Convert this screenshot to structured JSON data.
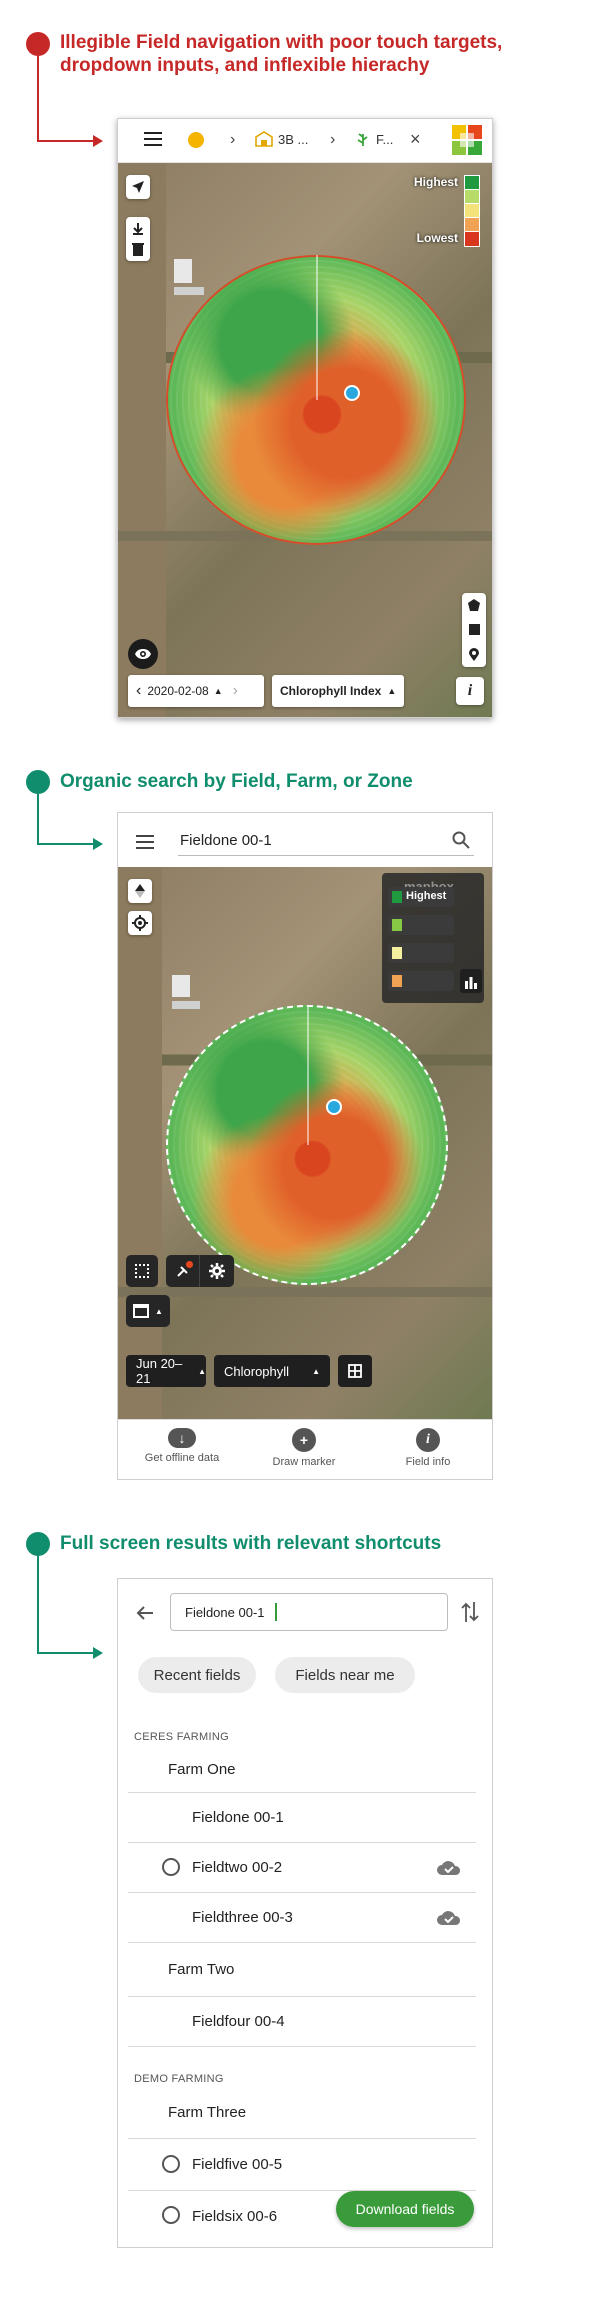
{
  "annotations": [
    {
      "title_line1": "Illegible Field navigation with poor touch targets,",
      "title_line2": "dropdown inputs, and inflexible hierachy",
      "color": "#c62828"
    },
    {
      "title_line1": "Organic search by Field, Farm, or Zone",
      "color": "#108d6d"
    },
    {
      "title_line1": "Full screen results with relevant shortcuts",
      "color": "#108d6d"
    }
  ],
  "screen1": {
    "breadcrumb": {
      "crumb1": "3B ...",
      "crumb2": "F..."
    },
    "legend": {
      "high": "Highest",
      "low": "Lowest",
      "colors": [
        "#1f9a3f",
        "#b7dc6a",
        "#f4e37a",
        "#f0a354",
        "#d9361f"
      ]
    },
    "date": "2020-02-08",
    "layer": "Chlorophyll Index",
    "info_label": "i"
  },
  "screen2": {
    "search_value": "Fieldone 00-1",
    "legend": {
      "high": "Highest",
      "watermark": "mapbox",
      "colors": [
        "#1f9a3f",
        "#86c945",
        "#f4f0a0",
        "#f0a354"
      ]
    },
    "date_tab": "Jun 20–21",
    "layer_tab": "Chlorophyll",
    "nav": [
      {
        "label": "Get offline data",
        "icon": "cloud-download-icon"
      },
      {
        "label": "Draw marker",
        "icon": "marker-add-icon"
      },
      {
        "label": "Field info",
        "icon": "info-icon"
      }
    ]
  },
  "screen3": {
    "search_value": "Fieldone 00-1",
    "chips": [
      "Recent fields",
      "Fields near me"
    ],
    "groups": [
      {
        "heading": "CERES FARMING",
        "items": [
          {
            "label": "Farm One",
            "kind": "farm"
          },
          {
            "label": "Fieldone 00-1",
            "kind": "field",
            "radio": false,
            "cloud": false
          },
          {
            "label": "Fieldtwo 00-2",
            "kind": "field",
            "radio": true,
            "cloud": true
          },
          {
            "label": "Fieldthree 00-3",
            "kind": "field",
            "radio": false,
            "cloud": true
          },
          {
            "label": "Farm Two",
            "kind": "farm"
          },
          {
            "label": "Fieldfour 00-4",
            "kind": "field",
            "radio": false,
            "cloud": false
          }
        ]
      },
      {
        "heading": "DEMO FARMING",
        "items": [
          {
            "label": "Farm Three",
            "kind": "farm"
          },
          {
            "label": "Fieldfive 00-5",
            "kind": "field",
            "radio": true,
            "cloud": false
          },
          {
            "label": "Fieldsix 00-6",
            "kind": "field",
            "radio": true,
            "cloud": false
          }
        ]
      }
    ],
    "download_button": "Download fields",
    "accent": "#3a9b3a"
  }
}
